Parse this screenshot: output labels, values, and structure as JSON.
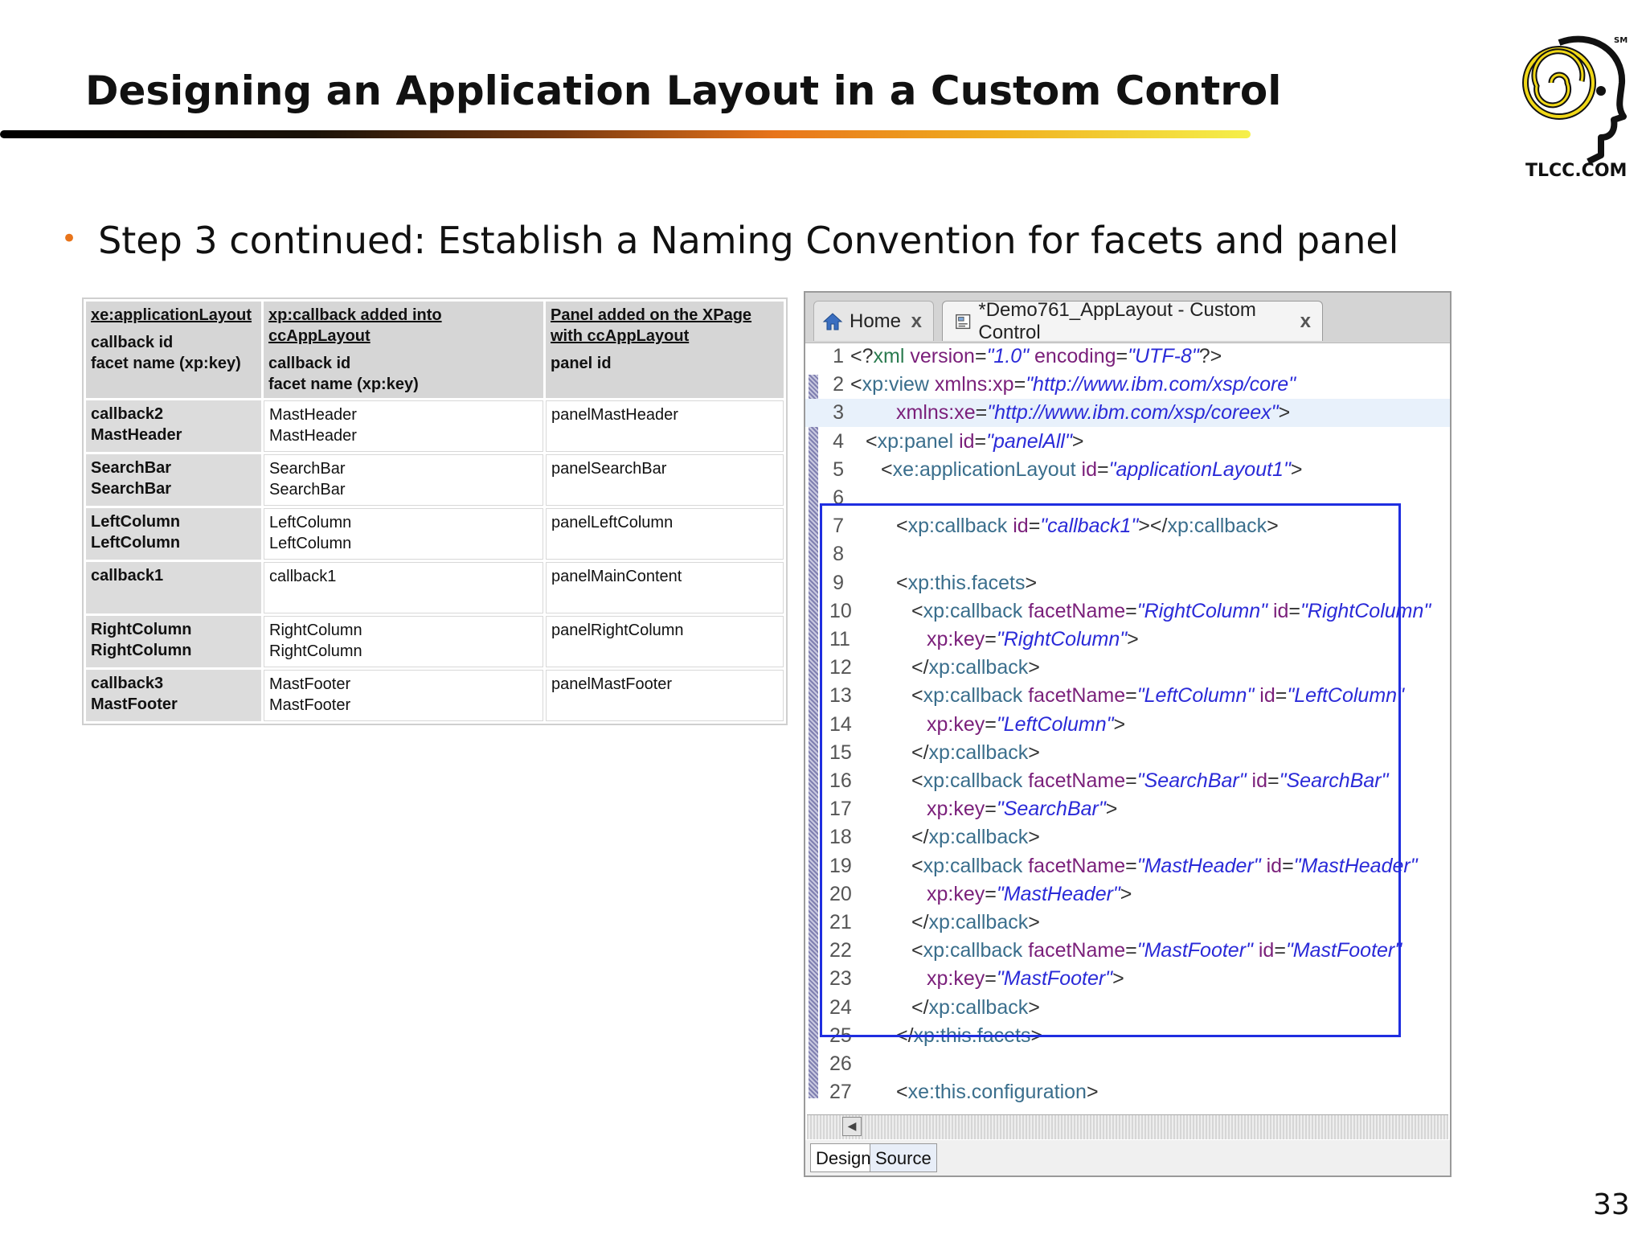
{
  "slide": {
    "title": "Designing an Application Layout in a Custom Control",
    "bullet": "Step 3 continued:  Establish a Naming Convention for facets and panel",
    "page_number": "33",
    "logo_text": "TLCC.COM",
    "logo_sm": "SM"
  },
  "table": {
    "headers": [
      {
        "title": "xe:applicationLayout",
        "lines": [
          "callback id",
          "facet name (xp:key)"
        ]
      },
      {
        "title": "xp:callback added into ccAppLayout",
        "lines": [
          "callback id",
          "facet name (xp:key)"
        ]
      },
      {
        "title": "Panel added on the XPage with ccAppLayout",
        "lines": [
          "panel id"
        ]
      }
    ],
    "rows": [
      [
        [
          "callback2",
          "MastHeader"
        ],
        [
          "MastHeader",
          "MastHeader"
        ],
        [
          "panelMastHeader"
        ]
      ],
      [
        [
          "SearchBar",
          "SearchBar"
        ],
        [
          "SearchBar",
          "SearchBar"
        ],
        [
          "panelSearchBar"
        ]
      ],
      [
        [
          "LeftColumn",
          "LeftColumn"
        ],
        [
          "LeftColumn",
          "LeftColumn"
        ],
        [
          "panelLeftColumn"
        ]
      ],
      [
        [
          "callback1"
        ],
        [
          "callback1"
        ],
        [
          "panelMainContent"
        ]
      ],
      [
        [
          "RightColumn",
          "RightColumn"
        ],
        [
          "RightColumn",
          "RightColumn"
        ],
        [
          "panelRightColumn"
        ]
      ],
      [
        [
          "callback3",
          "MastFooter"
        ],
        [
          "MastFooter",
          "MastFooter"
        ],
        [
          "panelMastFooter"
        ]
      ]
    ]
  },
  "editor": {
    "tabs": [
      {
        "label": "Home",
        "icon": "home-icon",
        "close": "x"
      },
      {
        "label": "*Demo761_AppLayout - Custom Control",
        "icon": "custom-control-icon",
        "close": "x"
      }
    ],
    "bottom_tabs": [
      "Design",
      "Source"
    ],
    "highlight_color": "#1f2ee0",
    "lines": [
      {
        "n": "1",
        "indent": 0,
        "parts": [
          [
            "punct",
            "<?"
          ],
          [
            "pi",
            "xml"
          ],
          [
            "attr",
            " version"
          ],
          [
            "punct",
            "="
          ],
          [
            "val",
            "\"1.0\""
          ],
          [
            "attr",
            " encoding"
          ],
          [
            "punct",
            "="
          ],
          [
            "val",
            "\"UTF-8\""
          ],
          [
            "punct",
            "?>"
          ]
        ]
      },
      {
        "n": "2",
        "indent": 0,
        "parts": [
          [
            "punct",
            "<"
          ],
          [
            "tag",
            "xp:view"
          ],
          [
            "attr",
            " xmlns:xp"
          ],
          [
            "punct",
            "="
          ],
          [
            "val",
            "\"http://www.ibm.com/xsp/core\""
          ]
        ]
      },
      {
        "n": "3",
        "indent": 3,
        "hl": true,
        "parts": [
          [
            "attr",
            "xmlns:xe"
          ],
          [
            "punct",
            "="
          ],
          [
            "val",
            "\"http://www.ibm.com/xsp/coreex\""
          ],
          [
            "punct",
            ">"
          ]
        ]
      },
      {
        "n": "4",
        "indent": 1,
        "parts": [
          [
            "punct",
            "<"
          ],
          [
            "tag",
            "xp:panel"
          ],
          [
            "attr",
            " id"
          ],
          [
            "punct",
            "="
          ],
          [
            "val",
            "\"panelAll\""
          ],
          [
            "punct",
            ">"
          ]
        ]
      },
      {
        "n": "5",
        "indent": 2,
        "parts": [
          [
            "punct",
            "<"
          ],
          [
            "tag",
            "xe:applicationLayout"
          ],
          [
            "attr",
            " id"
          ],
          [
            "punct",
            "="
          ],
          [
            "val",
            "\"applicationLayout1\""
          ],
          [
            "punct",
            ">"
          ]
        ]
      },
      {
        "n": "6",
        "indent": 0,
        "parts": []
      },
      {
        "n": "7",
        "indent": 3,
        "parts": [
          [
            "punct",
            "<"
          ],
          [
            "tag",
            "xp:callback"
          ],
          [
            "attr",
            " id"
          ],
          [
            "punct",
            "="
          ],
          [
            "val",
            "\"callback1\""
          ],
          [
            "punct",
            "></"
          ],
          [
            "tag",
            "xp:callback"
          ],
          [
            "punct",
            ">"
          ]
        ]
      },
      {
        "n": "8",
        "indent": 0,
        "parts": []
      },
      {
        "n": "9",
        "indent": 3,
        "parts": [
          [
            "punct",
            "<"
          ],
          [
            "tag",
            "xp:this.facets"
          ],
          [
            "punct",
            ">"
          ]
        ]
      },
      {
        "n": "10",
        "indent": 4,
        "parts": [
          [
            "punct",
            "<"
          ],
          [
            "tag",
            "xp:callback"
          ],
          [
            "attr",
            " facetName"
          ],
          [
            "punct",
            "="
          ],
          [
            "val",
            "\"RightColumn\""
          ],
          [
            "attr",
            " id"
          ],
          [
            "punct",
            "="
          ],
          [
            "val",
            "\"RightColumn\""
          ]
        ]
      },
      {
        "n": "11",
        "indent": 5,
        "parts": [
          [
            "attr",
            "xp:key"
          ],
          [
            "punct",
            "="
          ],
          [
            "val",
            "\"RightColumn\""
          ],
          [
            "punct",
            ">"
          ]
        ]
      },
      {
        "n": "12",
        "indent": 4,
        "parts": [
          [
            "punct",
            "</"
          ],
          [
            "tag",
            "xp:callback"
          ],
          [
            "punct",
            ">"
          ]
        ]
      },
      {
        "n": "13",
        "indent": 4,
        "parts": [
          [
            "punct",
            "<"
          ],
          [
            "tag",
            "xp:callback"
          ],
          [
            "attr",
            " facetName"
          ],
          [
            "punct",
            "="
          ],
          [
            "val",
            "\"LeftColumn\""
          ],
          [
            "attr",
            " id"
          ],
          [
            "punct",
            "="
          ],
          [
            "val",
            "\"LeftColumn\""
          ]
        ]
      },
      {
        "n": "14",
        "indent": 5,
        "parts": [
          [
            "attr",
            "xp:key"
          ],
          [
            "punct",
            "="
          ],
          [
            "val",
            "\"LeftColumn\""
          ],
          [
            "punct",
            ">"
          ]
        ]
      },
      {
        "n": "15",
        "indent": 4,
        "parts": [
          [
            "punct",
            "</"
          ],
          [
            "tag",
            "xp:callback"
          ],
          [
            "punct",
            ">"
          ]
        ]
      },
      {
        "n": "16",
        "indent": 4,
        "parts": [
          [
            "punct",
            "<"
          ],
          [
            "tag",
            "xp:callback"
          ],
          [
            "attr",
            " facetName"
          ],
          [
            "punct",
            "="
          ],
          [
            "val",
            "\"SearchBar\""
          ],
          [
            "attr",
            " id"
          ],
          [
            "punct",
            "="
          ],
          [
            "val",
            "\"SearchBar\""
          ]
        ]
      },
      {
        "n": "17",
        "indent": 5,
        "parts": [
          [
            "attr",
            "xp:key"
          ],
          [
            "punct",
            "="
          ],
          [
            "val",
            "\"SearchBar\""
          ],
          [
            "punct",
            ">"
          ]
        ]
      },
      {
        "n": "18",
        "indent": 4,
        "parts": [
          [
            "punct",
            "</"
          ],
          [
            "tag",
            "xp:callback"
          ],
          [
            "punct",
            ">"
          ]
        ]
      },
      {
        "n": "19",
        "indent": 4,
        "parts": [
          [
            "punct",
            "<"
          ],
          [
            "tag",
            "xp:callback"
          ],
          [
            "attr",
            " facetName"
          ],
          [
            "punct",
            "="
          ],
          [
            "val",
            "\"MastHeader\""
          ],
          [
            "attr",
            " id"
          ],
          [
            "punct",
            "="
          ],
          [
            "val",
            "\"MastHeader\""
          ]
        ]
      },
      {
        "n": "20",
        "indent": 5,
        "parts": [
          [
            "attr",
            "xp:key"
          ],
          [
            "punct",
            "="
          ],
          [
            "val",
            "\"MastHeader\""
          ],
          [
            "punct",
            ">"
          ]
        ]
      },
      {
        "n": "21",
        "indent": 4,
        "parts": [
          [
            "punct",
            "</"
          ],
          [
            "tag",
            "xp:callback"
          ],
          [
            "punct",
            ">"
          ]
        ]
      },
      {
        "n": "22",
        "indent": 4,
        "parts": [
          [
            "punct",
            "<"
          ],
          [
            "tag",
            "xp:callback"
          ],
          [
            "attr",
            " facetName"
          ],
          [
            "punct",
            "="
          ],
          [
            "val",
            "\"MastFooter\""
          ],
          [
            "attr",
            " id"
          ],
          [
            "punct",
            "="
          ],
          [
            "val",
            "\"MastFooter\""
          ]
        ]
      },
      {
        "n": "23",
        "indent": 5,
        "parts": [
          [
            "attr",
            "xp:key"
          ],
          [
            "punct",
            "="
          ],
          [
            "val",
            "\"MastFooter\""
          ],
          [
            "punct",
            ">"
          ]
        ]
      },
      {
        "n": "24",
        "indent": 4,
        "parts": [
          [
            "punct",
            "</"
          ],
          [
            "tag",
            "xp:callback"
          ],
          [
            "punct",
            ">"
          ]
        ]
      },
      {
        "n": "25",
        "indent": 3,
        "parts": [
          [
            "punct",
            "</"
          ],
          [
            "tag",
            "xp:this.facets"
          ],
          [
            "punct",
            ">"
          ]
        ]
      },
      {
        "n": "26",
        "indent": 0,
        "parts": []
      },
      {
        "n": "27",
        "indent": 3,
        "parts": [
          [
            "punct",
            "<"
          ],
          [
            "tag",
            "xe:this.configuration"
          ],
          [
            "punct",
            ">"
          ]
        ]
      }
    ]
  }
}
